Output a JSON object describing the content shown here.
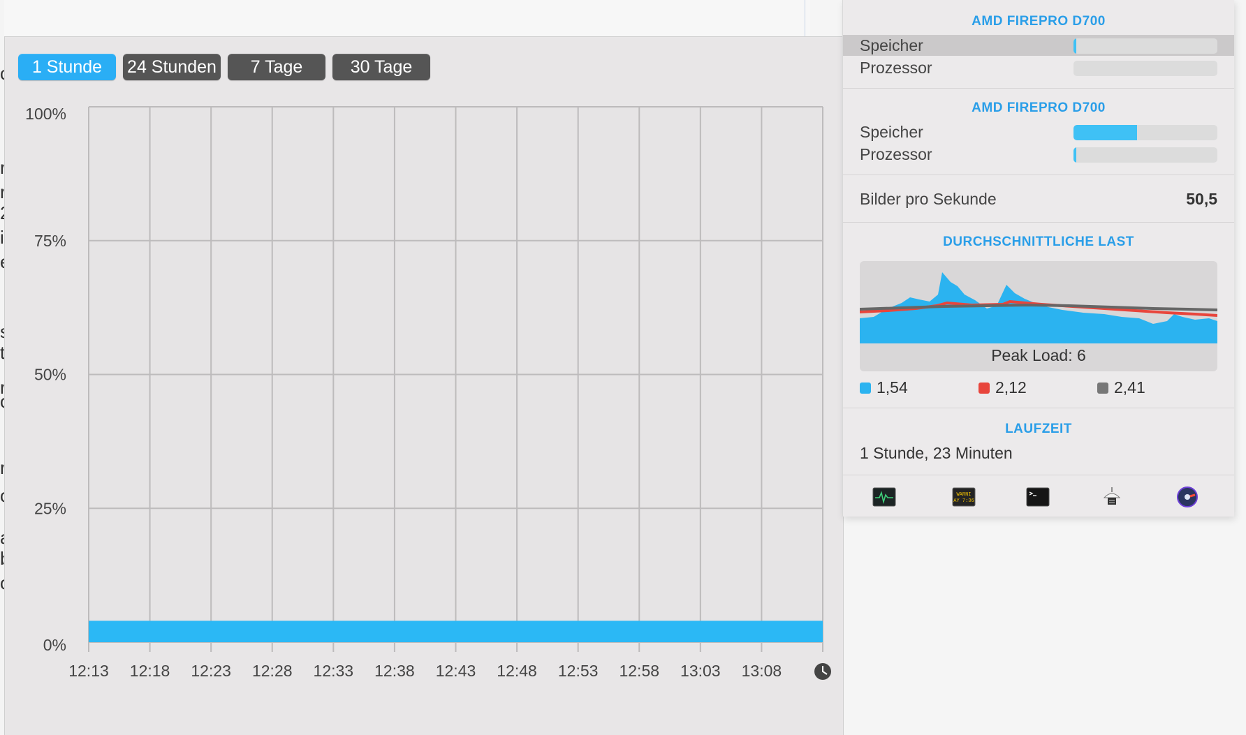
{
  "background": {
    "edge_chars": [
      "c",
      "r",
      "r",
      "2",
      "i",
      "e",
      "s",
      "t",
      "r",
      "o",
      "r",
      "o",
      "a",
      "b",
      "o"
    ]
  },
  "history": {
    "ranges": [
      {
        "label": "1 Stunde",
        "active": true
      },
      {
        "label": "24 Stunden",
        "active": false
      },
      {
        "label": "7 Tage",
        "active": false
      },
      {
        "label": "30 Tage",
        "active": false
      }
    ]
  },
  "chart_data": {
    "type": "area",
    "y_ticks": [
      "100%",
      "75%",
      "50%",
      "25%",
      "0%"
    ],
    "x": [
      "12:13",
      "12:18",
      "12:23",
      "12:28",
      "12:33",
      "12:38",
      "12:43",
      "12:48",
      "12:53",
      "12:58",
      "13:03",
      "13:08"
    ],
    "series": [
      {
        "values": [
          4,
          4,
          4,
          4,
          4,
          4,
          4,
          4,
          4,
          4,
          4,
          4,
          4
        ],
        "color": "#2bb8f5"
      }
    ],
    "ylim": [
      0,
      100
    ],
    "grid": true,
    "clock_icon": "clock-icon"
  },
  "panel": {
    "gpu1": {
      "title": "AMD FIREPRO D700",
      "memory_label": "Speicher",
      "memory_level": 0.02,
      "processor_label": "Prozessor",
      "processor_level": 0.0
    },
    "gpu2": {
      "title": "AMD FIREPRO D700",
      "memory_label": "Speicher",
      "memory_level": 0.44,
      "processor_label": "Prozessor",
      "processor_level": 0.02
    },
    "fps": {
      "label": "Bilder pro Sekunde",
      "value": "50,5"
    },
    "load": {
      "title": "DURCHSCHNITTLICHE LAST",
      "peak": "Peak Load: 6",
      "legend": [
        {
          "value": "1,54",
          "color": "#2bb3f0"
        },
        {
          "value": "2,12",
          "color": "#e8453c"
        },
        {
          "value": "2,41",
          "color": "#777777"
        }
      ]
    },
    "uptime": {
      "title": "LAUFZEIT",
      "value": "1 Stunde, 23 Minuten"
    },
    "tools": [
      {
        "icon": "activity-monitor-icon"
      },
      {
        "icon": "console-warning-icon",
        "text": "WARNI\nAY 7:36"
      },
      {
        "icon": "terminal-icon"
      },
      {
        "icon": "system-information-icon"
      },
      {
        "icon": "disk-utility-icon"
      }
    ]
  }
}
